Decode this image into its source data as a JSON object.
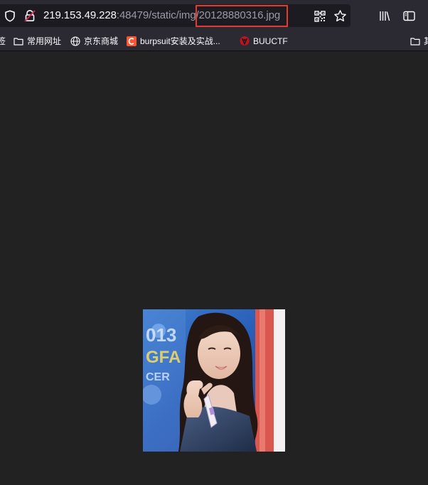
{
  "browser": {
    "url_host": "219.153.49.228",
    "url_rest_before": ":48479/static/img/",
    "url_highlighted": "20128880316.jpg",
    "highlight_color": "#e53a2f",
    "icons": {
      "left": [
        "shield-icon",
        "lock-icon"
      ],
      "right": [
        "qr-code-icon",
        "star-icon",
        "library-icon",
        "sidebar-icon"
      ]
    }
  },
  "bookmarks": {
    "edge_left_label": "签",
    "items": [
      {
        "label": "常用网址",
        "icon": "folder-icon"
      },
      {
        "label": "京东商城",
        "icon": "globe-icon"
      },
      {
        "label": "burpsuit安装及实战...",
        "icon": "csdn-icon"
      },
      {
        "label": "BUUCTF",
        "icon": "buuctf-icon"
      }
    ],
    "edge_right_label": "其"
  },
  "content": {
    "background": "#222222",
    "image": {
      "name": "20128880316.jpg",
      "description_icon": "photo"
    }
  }
}
